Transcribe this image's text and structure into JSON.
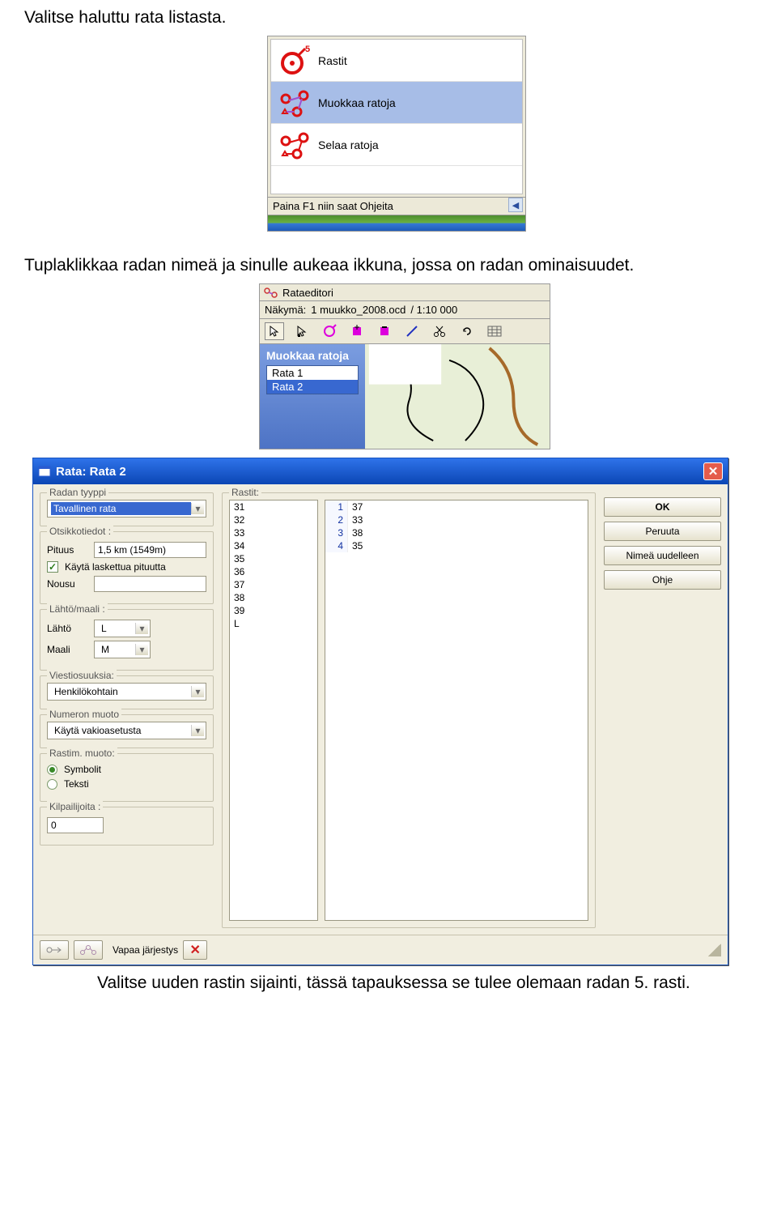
{
  "doc": {
    "p1": "Valitse haluttu rata listasta.",
    "p2": "Tuplaklikkaa radan nimeä ja sinulle aukeaa ikkuna, jossa on radan ominaisuudet.",
    "p3": "Valitse uuden rastin sijainti, tässä tapauksessa se tulee olemaan radan 5. rasti."
  },
  "sidetools": {
    "items": [
      {
        "label": "Rastit",
        "icon": "control-icon",
        "selected": false
      },
      {
        "label": "Muokkaa ratoja",
        "icon": "edit-course-icon",
        "selected": true
      },
      {
        "label": "Selaa ratoja",
        "icon": "browse-course-icon",
        "selected": false
      }
    ],
    "status": "Paina F1 niin saat Ohjeita"
  },
  "editor": {
    "title": "Rataeditori",
    "view_label": "Näkymä:",
    "view_file": "1 muukko_2008.ocd",
    "scale": "/ 1:10 000",
    "side_title": "Muokkaa ratoja",
    "rows": [
      {
        "label": "Rata 1",
        "selected": false
      },
      {
        "label": "Rata 2",
        "selected": true
      }
    ]
  },
  "dialog": {
    "title": "Rata: Rata 2",
    "type": {
      "legend": "Radan tyyppi",
      "value": "Tavallinen rata"
    },
    "header": {
      "legend": "Otsikkotiedot :",
      "length_label": "Pituus",
      "length_value": "1,5 km (1549m)",
      "use_calc": "Käytä laskettua pituutta",
      "climb_label": "Nousu",
      "climb_value": ""
    },
    "startfinish": {
      "legend": "Lähtö/maali :",
      "start_label": "Lähtö",
      "start_value": "L",
      "finish_label": "Maali",
      "finish_value": "M"
    },
    "relay": {
      "legend": "Viestiosuuksia:",
      "value": "Henkilökohtain"
    },
    "numfmt": {
      "legend": "Numeron muoto",
      "value": "Käytä vakioasetusta"
    },
    "descfmt": {
      "legend": "Rastim. muoto:",
      "opt1": "Symbolit",
      "opt2": "Teksti",
      "selected": "Symbolit"
    },
    "competitors": {
      "legend": "Kilpailijoita :",
      "value": "0"
    },
    "rastit": {
      "legend": "Rastit:",
      "available": [
        "31",
        "32",
        "33",
        "34",
        "35",
        "36",
        "37",
        "38",
        "39",
        "L"
      ],
      "selected": [
        {
          "n": "1",
          "code": "37"
        },
        {
          "n": "2",
          "code": "33"
        },
        {
          "n": "3",
          "code": "38"
        },
        {
          "n": "4",
          "code": "35"
        }
      ]
    },
    "buttons": {
      "ok": "OK",
      "cancel": "Peruuta",
      "rename": "Nimeä uudelleen",
      "help": "Ohje"
    },
    "footer": {
      "free": "Vapaa järjestys"
    }
  }
}
